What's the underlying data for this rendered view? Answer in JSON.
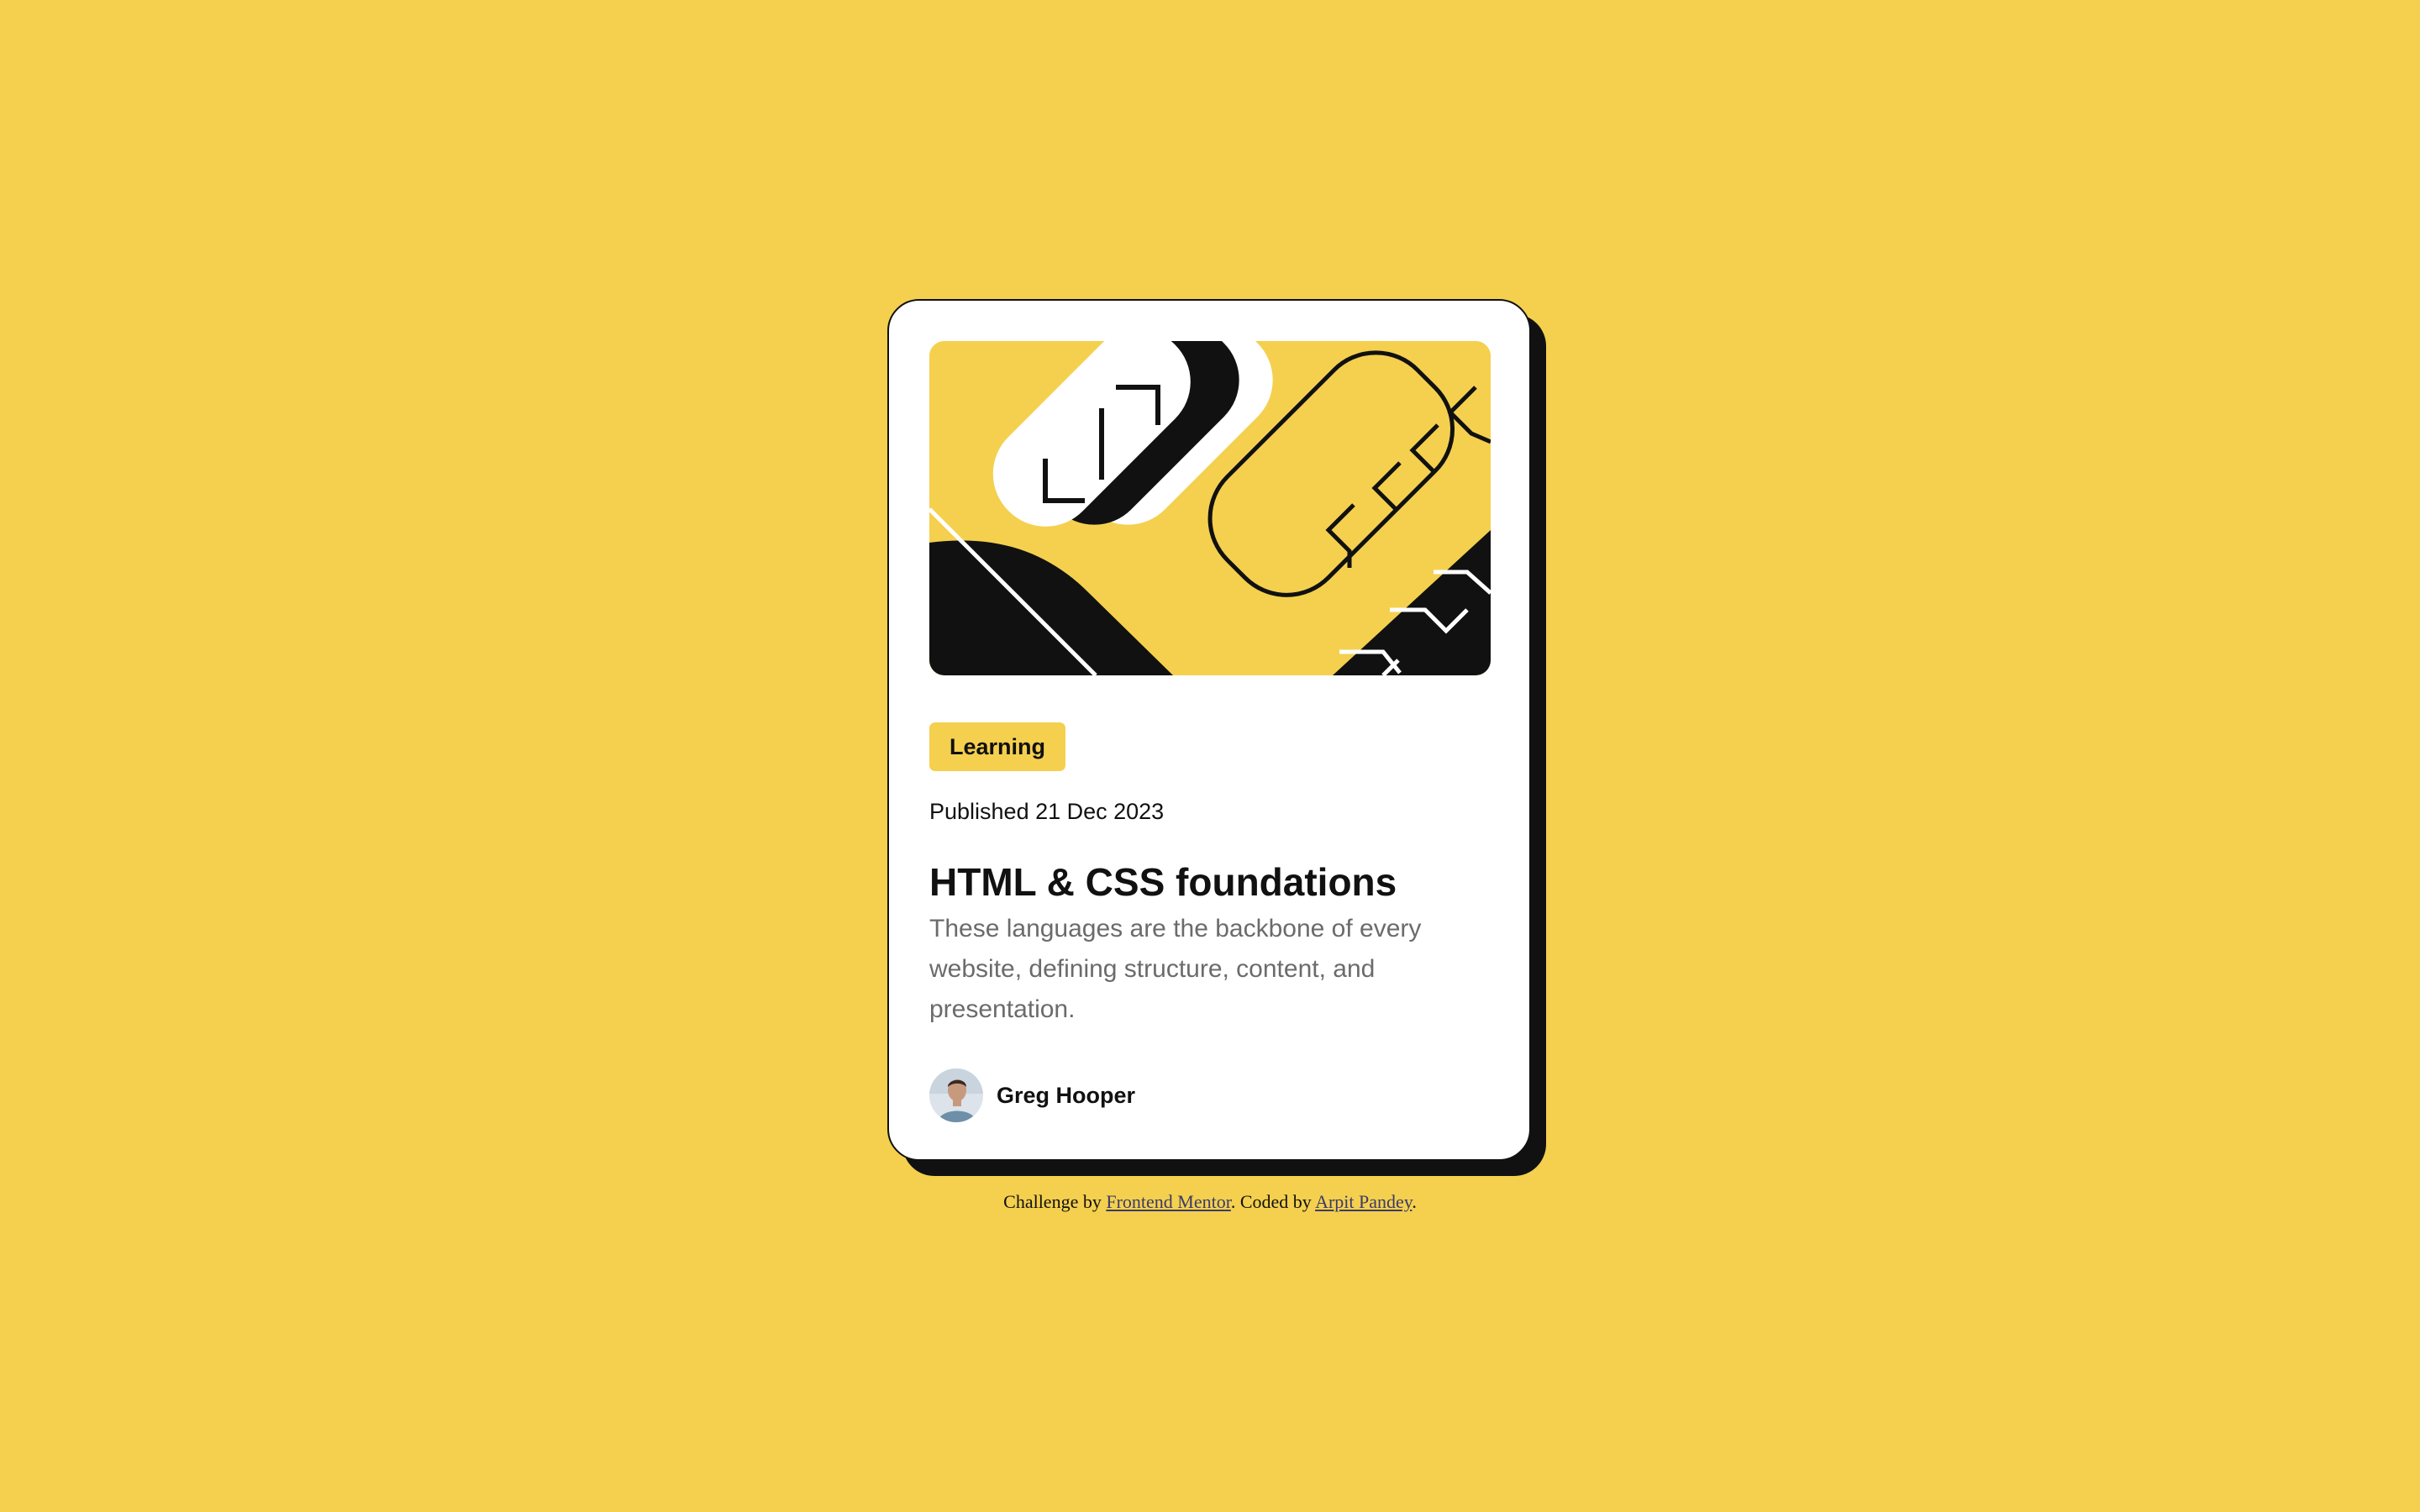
{
  "card": {
    "category_tag": "Learning",
    "published": "Published 21 Dec 2023",
    "title": "HTML & CSS foundations",
    "description": "These languages are the backbone of every website, defining structure, content, and presentation.",
    "author": {
      "name": "Greg Hooper",
      "avatar_icon": "avatar-photo"
    },
    "hero_illustration": "abstract-illustration"
  },
  "footer": {
    "prefix": "Challenge by ",
    "link1": "Frontend Mentor",
    "middle": ". Coded by ",
    "link2": "Arpit Pandey",
    "suffix": "."
  },
  "colors": {
    "background": "#F4D04E",
    "card": "#FFFFFF",
    "ink": "#111111",
    "muted_text": "#6B6B6B",
    "tag": "#F4D04E"
  }
}
